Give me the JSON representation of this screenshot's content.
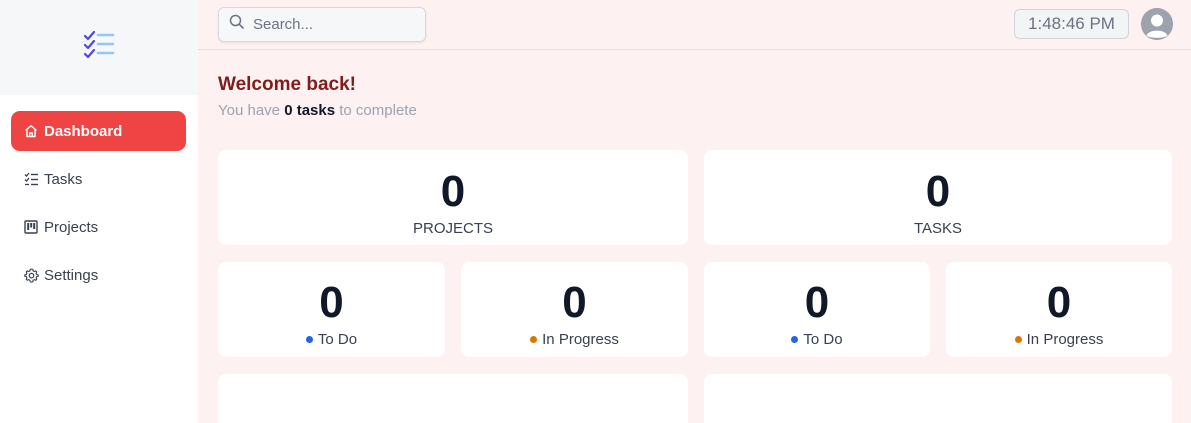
{
  "sidebar": {
    "items": [
      {
        "label": "Dashboard",
        "icon": "home-icon",
        "active": true
      },
      {
        "label": "Tasks",
        "icon": "task-list-icon"
      },
      {
        "label": "Projects",
        "icon": "kanban-icon"
      },
      {
        "label": "Settings",
        "icon": "gear-icon"
      }
    ]
  },
  "header": {
    "search_placeholder": "Search...",
    "time": "1:48:46 PM"
  },
  "main": {
    "welcome": "Welcome back!",
    "subtitle_prefix": "You have",
    "subtitle_count": "0",
    "subtitle_unit": "tasks",
    "subtitle_suffix": "to complete",
    "stats": [
      {
        "value": "0",
        "label": "PROJECTS"
      },
      {
        "value": "0",
        "label": "TASKS"
      }
    ],
    "status_cards": [
      {
        "value": "0",
        "label": "To Do",
        "color": "#2563eb"
      },
      {
        "value": "0",
        "label": "In Progress",
        "color": "#d97706"
      },
      {
        "value": "0",
        "label": "To Do",
        "color": "#2563eb"
      },
      {
        "value": "0",
        "label": "In Progress",
        "color": "#d97706"
      }
    ]
  },
  "colors": {
    "accent": "#ef4444",
    "background": "#fef1f1",
    "welcome": "#7f1d1d"
  }
}
